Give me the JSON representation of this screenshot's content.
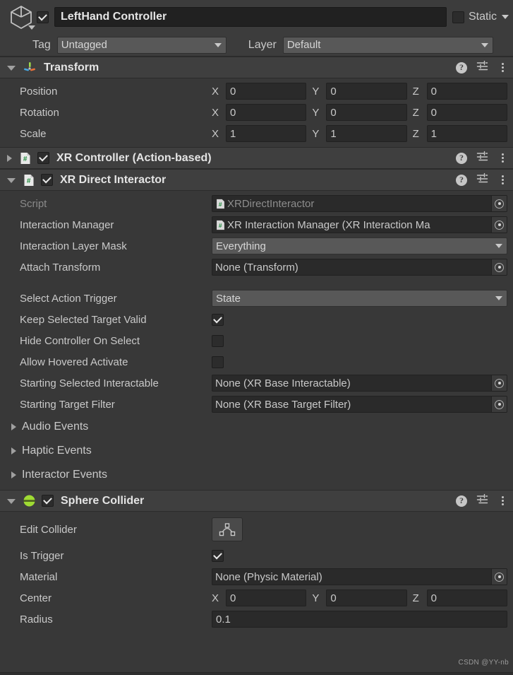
{
  "header": {
    "gameobject_icon": "cube-icon",
    "enabled": true,
    "name": "LeftHand Controller",
    "static_checked": false,
    "static_label": "Static",
    "tag_label": "Tag",
    "tag_value": "Untagged",
    "layer_label": "Layer",
    "layer_value": "Default"
  },
  "components": [
    {
      "name": "Transform",
      "icon": "transform-axes-icon",
      "expanded": true,
      "has_enable_checkbox": false,
      "rows": [
        {
          "type": "vector3",
          "label": "Position",
          "x": "0",
          "y": "0",
          "z": "0"
        },
        {
          "type": "vector3",
          "label": "Rotation",
          "x": "0",
          "y": "0",
          "z": "0"
        },
        {
          "type": "vector3",
          "label": "Scale",
          "x": "1",
          "y": "1",
          "z": "1"
        }
      ]
    },
    {
      "name": "XR Controller (Action-based)",
      "icon": "csharp-script-icon",
      "expanded": false,
      "has_enable_checkbox": true,
      "enabled": true,
      "rows": []
    },
    {
      "name": "XR Direct Interactor",
      "icon": "csharp-script-icon",
      "expanded": true,
      "has_enable_checkbox": true,
      "enabled": true,
      "rows": [
        {
          "type": "object",
          "label": "Script",
          "value": "XRDirectInteractor",
          "readonly": true,
          "has_type_icon": true
        },
        {
          "type": "object",
          "label": "Interaction Manager",
          "value": "XR Interaction Manager (XR Interaction Ma",
          "readonly": false,
          "has_type_icon": true
        },
        {
          "type": "dropdown",
          "label": "Interaction Layer Mask",
          "value": "Everything"
        },
        {
          "type": "object",
          "label": "Attach Transform",
          "value": "None (Transform)",
          "readonly": false,
          "has_type_icon": false
        },
        {
          "type": "spacer"
        },
        {
          "type": "dropdown",
          "label": "Select Action Trigger",
          "value": "State"
        },
        {
          "type": "checkbox",
          "label": "Keep Selected Target Valid",
          "checked": true
        },
        {
          "type": "checkbox",
          "label": "Hide Controller On Select",
          "checked": false
        },
        {
          "type": "checkbox",
          "label": "Allow Hovered Activate",
          "checked": false
        },
        {
          "type": "object",
          "label": "Starting Selected Interactable",
          "value": "None (XR Base Interactable)",
          "readonly": false,
          "has_type_icon": false
        },
        {
          "type": "object",
          "label": "Starting Target Filter",
          "value": "None (XR Base Target Filter)",
          "readonly": false,
          "has_type_icon": false
        },
        {
          "type": "foldout",
          "label": "Audio Events",
          "expanded": false
        },
        {
          "type": "foldout",
          "label": "Haptic Events",
          "expanded": false
        },
        {
          "type": "foldout",
          "label": "Interactor Events",
          "expanded": false
        }
      ]
    },
    {
      "name": "Sphere Collider",
      "icon": "sphere-collider-icon",
      "expanded": true,
      "has_enable_checkbox": true,
      "enabled": true,
      "rows": [
        {
          "type": "edit-collider",
          "label": "Edit Collider",
          "button_icon": "edit-collider-icon"
        },
        {
          "type": "checkbox",
          "label": "Is Trigger",
          "checked": true
        },
        {
          "type": "object",
          "label": "Material",
          "value": "None (Physic Material)",
          "readonly": false,
          "has_type_icon": false
        },
        {
          "type": "vector3",
          "label": "Center",
          "x": "0",
          "y": "0",
          "z": "0"
        },
        {
          "type": "text",
          "label": "Radius",
          "value": "0.1"
        }
      ]
    }
  ],
  "header_icons": {
    "help": "?",
    "preset": "preset-icon",
    "menu": "more-menu-icon"
  },
  "watermark": "CSDN @YY-nb",
  "colors": {
    "window_bg": "#383838",
    "header_bg": "#3f3f3f",
    "field_bg": "#2a2a2a",
    "dropdown_bg": "#585858",
    "accent_green": "#9acd32",
    "text": "#c9c9c9"
  }
}
